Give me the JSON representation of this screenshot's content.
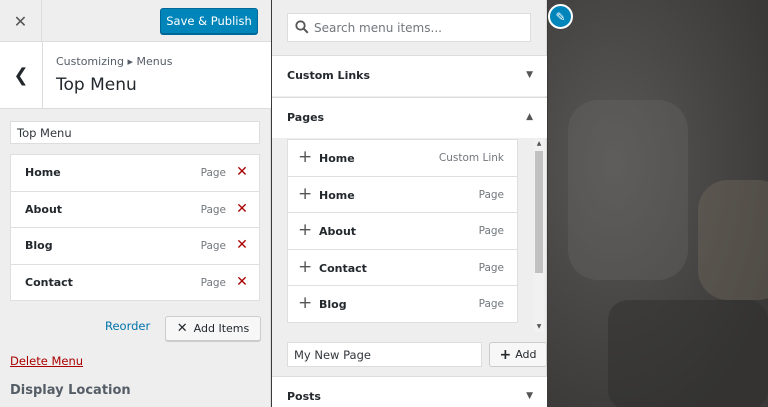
{
  "header": {
    "close_icon": "close-icon",
    "publish_label": "Save & Publish"
  },
  "section": {
    "breadcrumb": "Customizing ▸ Menus",
    "title": "Top Menu"
  },
  "menu": {
    "name_value": "Top Menu",
    "items": [
      {
        "title": "Home",
        "type": "Page"
      },
      {
        "title": "About",
        "type": "Page"
      },
      {
        "title": "Blog",
        "type": "Page"
      },
      {
        "title": "Contact",
        "type": "Page"
      }
    ],
    "reorder_label": "Reorder",
    "add_items_label": "Add Items",
    "delete_label": "Delete Menu",
    "display_location_label": "Display Location"
  },
  "available": {
    "search_placeholder": "Search menu items...",
    "sections": {
      "custom_links": "Custom Links",
      "pages": "Pages",
      "posts": "Posts"
    },
    "pages": [
      {
        "title": "Home",
        "type": "Custom Link"
      },
      {
        "title": "Home",
        "type": "Page"
      },
      {
        "title": "About",
        "type": "Page"
      },
      {
        "title": "Contact",
        "type": "Page"
      },
      {
        "title": "Blog",
        "type": "Page"
      }
    ],
    "new_page_value": "My New Page",
    "add_label": "Add"
  },
  "colors": {
    "primary": "#0085ba",
    "remove": "#aa0000",
    "link": "#0073aa"
  }
}
